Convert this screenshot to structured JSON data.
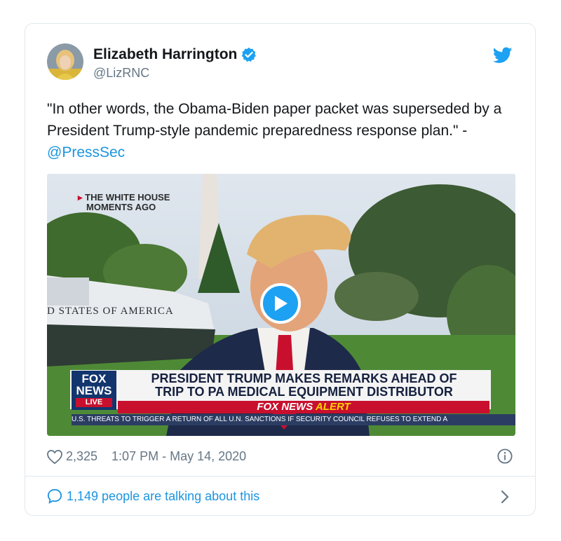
{
  "author": {
    "name": "Elizabeth Harrington",
    "handle": "@LizRNC",
    "verified": true
  },
  "tweet": {
    "text": "\"In other words, the Obama-Biden paper packet was superseded by a President Trump-style pandemic preparedness response plan.\" - ",
    "mention": "@PressSec"
  },
  "video": {
    "location_line1": "THE WHITE HOUSE",
    "location_line2": "MOMENTS AGO",
    "aircraft_text": "D STATES OF AMERICA",
    "network_logo_line1": "FOX",
    "network_logo_line2": "NEWS",
    "live_label": "LIVE",
    "headline_line1": "PRESIDENT TRUMP MAKES REMARKS AHEAD OF",
    "headline_line2": "TRIP TO PA MEDICAL EQUIPMENT DISTRIBUTOR",
    "alert_prefix": "FOX NEWS",
    "alert_word": "ALERT",
    "ticker": "U.S. THREATS TO TRIGGER A RETURN OF ALL U.N. SANCTIONS IF SECURITY COUNCIL REFUSES TO EXTEND A"
  },
  "footer": {
    "like_count": "2,325",
    "timestamp": "1:07 PM - May 14, 2020",
    "conversation": "1,149 people are talking about this"
  },
  "colors": {
    "accent": "#1da1f2",
    "link": "#1b95e0",
    "muted": "#657786",
    "alert_red": "#c8102e",
    "fox_blue": "#13356e"
  },
  "icons": [
    "verified-badge-icon",
    "twitter-bird-icon",
    "heart-icon",
    "info-icon",
    "speech-bubble-icon",
    "chevron-right-icon",
    "play-icon"
  ]
}
